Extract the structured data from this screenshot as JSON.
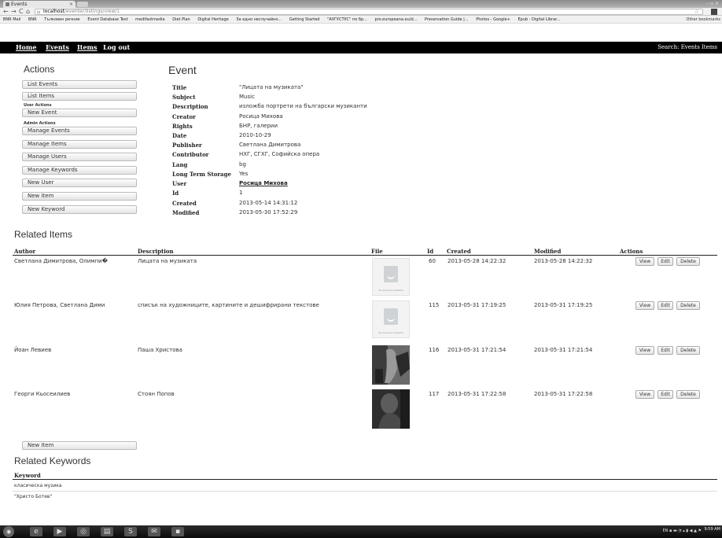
{
  "browser": {
    "tab_title": "Events",
    "url_host": "localhost",
    "url_path": "/eventer/listings/view/1",
    "bookmarks": [
      "BNR Mail",
      "BNR",
      "Тълковен речник",
      "Event Database Test",
      "medifastmedia",
      "Diet Plan",
      "Digital Heritage",
      "За едно неслучайно...",
      "Getting Started",
      "\"АУГУСТУС\" по бр...",
      "pro.europeana.eu/d...",
      "Preservation Guide |...",
      "Photos - Google+",
      "Epub : Digital Librar..."
    ],
    "other_bookmarks": "Other bookmarks"
  },
  "nav": {
    "home": "Home",
    "events": "Events",
    "items": "Items",
    "logout": "Log out",
    "search_label": "Search:",
    "search_events": "Events",
    "search_items": "Items"
  },
  "actions": {
    "title": "Actions",
    "list_events": "List Events",
    "list_items": "List Items",
    "user_actions_label": "User Actions",
    "new_event": "New Event",
    "admin_actions_label": "Admin Actions",
    "manage_events": "Manage Events",
    "manage_items": "Manage Items",
    "manage_users": "Manage Users",
    "manage_keywords": "Manage Keywords",
    "new_user": "New User",
    "new_item": "New Item",
    "new_keyword": "New Keyword"
  },
  "event": {
    "heading": "Event",
    "fields": [
      {
        "label": "Title",
        "value": "\"Лицата на музиката\""
      },
      {
        "label": "Subject",
        "value": "Music"
      },
      {
        "label": "Description",
        "value": "изложба портрети на български музиканти"
      },
      {
        "label": "Creator",
        "value": "Росица Михова"
      },
      {
        "label": "Rights",
        "value": "БНР, галерии"
      },
      {
        "label": "Date",
        "value": "2010-10-29"
      },
      {
        "label": "Publisher",
        "value": "Светлана Димитрова"
      },
      {
        "label": "Contributor",
        "value": "НХГ, СГХГ, Софийска опера"
      },
      {
        "label": "Lang",
        "value": "bg"
      },
      {
        "label": "Long Term Storage",
        "value": "Yes"
      },
      {
        "label": "User",
        "value": "Росица Михова"
      },
      {
        "label": "Id",
        "value": "1"
      },
      {
        "label": "Created",
        "value": "2013-05-14 14:31:12"
      },
      {
        "label": "Modified",
        "value": "2013-05-30 17:52:29"
      }
    ]
  },
  "related_items": {
    "heading": "Related Items",
    "columns": [
      "Author",
      "Description",
      "File",
      "Id",
      "Created",
      "Modified",
      "Actions"
    ],
    "no_preview": "No preview available",
    "view": "View",
    "edit": "Edit",
    "delete": "Delete",
    "rows": [
      {
        "author": "Светлана Димитрова, Олимпи�",
        "description": "Лицата на музиката",
        "id": "60",
        "created": "2013-05-28 14:22:32",
        "modified": "2013-05-28 14:22:32"
      },
      {
        "author": "Юлия Петрова, Светлана Дими",
        "description": "списък на художниците, картините и дешифрирани текстове",
        "id": "115",
        "created": "2013-05-31 17:19:25",
        "modified": "2013-05-31 17:19:25"
      },
      {
        "author": "Йоан Левиев",
        "description": "Паша Христова",
        "id": "116",
        "created": "2013-05-31 17:21:54",
        "modified": "2013-05-31 17:21:54"
      },
      {
        "author": "Георги Кьосеилиев",
        "description": "Стоян Попов",
        "id": "117",
        "created": "2013-05-31 17:22:58",
        "modified": "2013-05-31 17:22:58"
      }
    ],
    "new_item": "New Item"
  },
  "related_keywords": {
    "heading": "Related Keywords",
    "column": "Keyword",
    "rows": [
      "класическа музика",
      "\"Христо Ботев\""
    ]
  },
  "taskbar": {
    "lang": "EN",
    "time": "9:59 AM"
  }
}
